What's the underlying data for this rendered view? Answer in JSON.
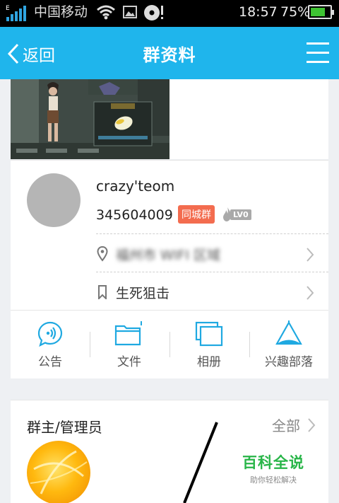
{
  "status_bar": {
    "carrier": "中国移动",
    "time": "18:57",
    "battery_percent": "75%",
    "battery_level": 0.75,
    "network_label": "E"
  },
  "title_bar": {
    "back_label": "返回",
    "title": "群资料",
    "menu_icon": "menu-icon"
  },
  "group": {
    "name": "crazy'teom",
    "id": "345604009",
    "badge": "同城群",
    "level": "LV0",
    "location": "福州市 WIFI 区域",
    "category": "生死狙击"
  },
  "actions": [
    {
      "label": "公告",
      "icon": "announcement-icon"
    },
    {
      "label": "文件",
      "icon": "folder-icon"
    },
    {
      "label": "相册",
      "icon": "album-icon"
    },
    {
      "label": "兴趣部落",
      "icon": "tribe-icon"
    }
  ],
  "admins": {
    "title": "群主/管理员",
    "all_label": "全部"
  },
  "watermark": {
    "title": "百科全说",
    "subtitle": "助你轻松解决"
  },
  "colors": {
    "accent": "#1fb5ec",
    "badge": "#f36c4f",
    "watermark": "#28b548"
  }
}
